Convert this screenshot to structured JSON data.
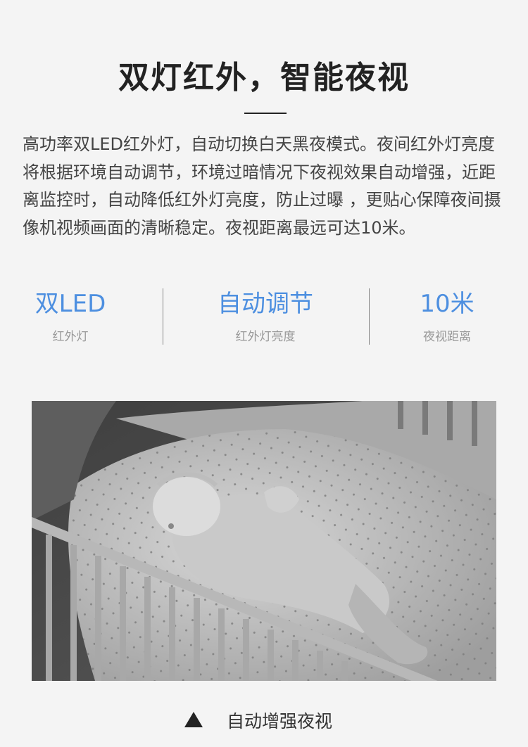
{
  "header": {
    "title": "双灯红外，智能夜视"
  },
  "description": "高功率双LED红外灯，自动切换白天黑夜模式。夜间红外灯亮度将根据环境自动调节，环境过暗情况下夜视效果自动增强，近距离监控时，自动降低红外灯亮度，防止过曝 ，更贴心保障夜间摄像机视频画面的清晰稳定。夜视距离最远可达10米。",
  "stats": [
    {
      "value": "双LED",
      "label": "红外灯"
    },
    {
      "value": "自动调节",
      "label": "红外灯亮度"
    },
    {
      "value": "10米",
      "label": "夜视距离"
    }
  ],
  "photo": {
    "icon": "sleeping-baby-crib-image"
  },
  "caption": {
    "icon": "triangle-up-icon",
    "text": "自动增强夜视"
  },
  "colors": {
    "accent": "#4d8fe0",
    "background": "#f4f4f4"
  }
}
